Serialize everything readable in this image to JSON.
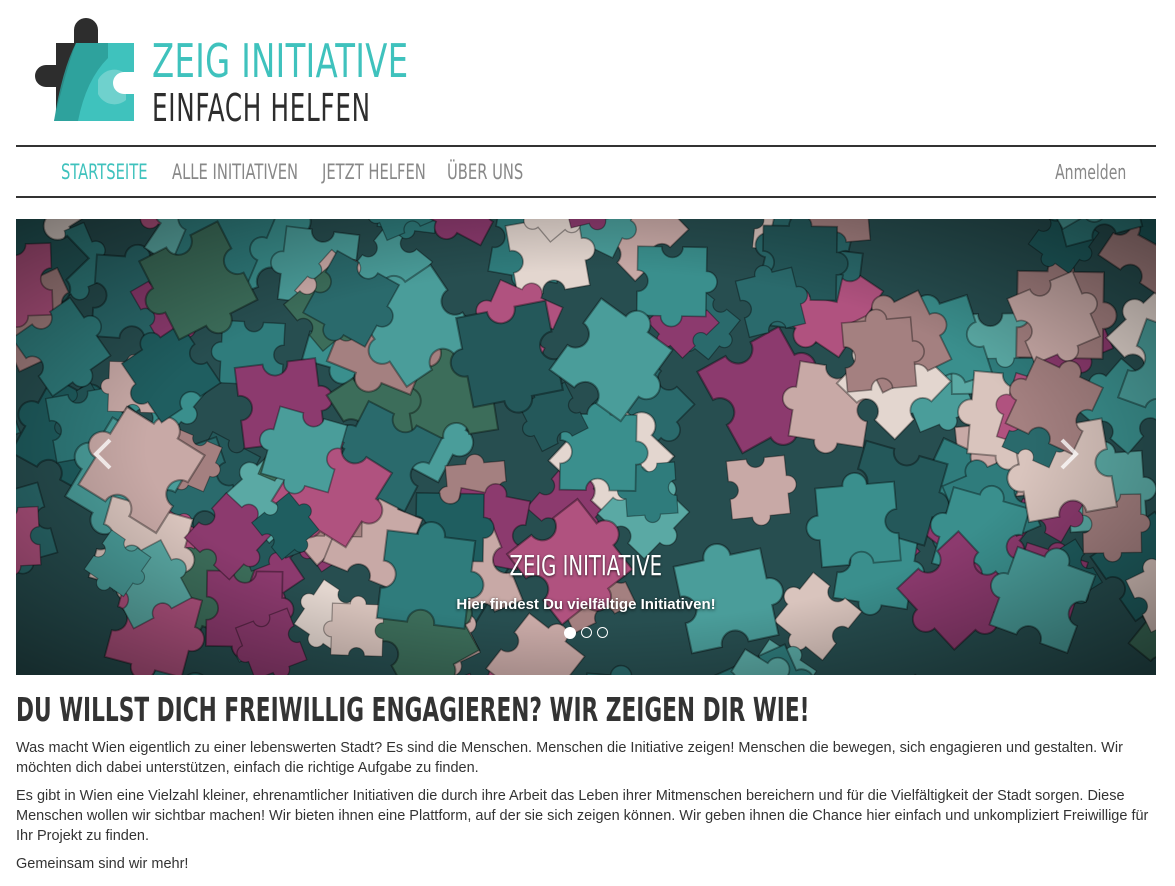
{
  "brand": {
    "title": "ZEIG INITIATIVE",
    "subtitle": "EINFACH HELFEN",
    "colors": {
      "accent": "#3fc2bd",
      "dark": "#2d2d2d",
      "nav_inactive": "#888888"
    }
  },
  "nav": {
    "items": [
      {
        "label": "STARTSEITE",
        "active": true
      },
      {
        "label": "ALLE INITIATIVEN",
        "active": false
      },
      {
        "label": "JETZT HELFEN",
        "active": false
      },
      {
        "label": "ÜBER UNS",
        "active": false
      }
    ],
    "login_label": "Anmelden"
  },
  "carousel": {
    "caption_title": "ZEIG INITIATIVE",
    "caption_text": "Hier findest Du vielfältige Initiativen!",
    "slides": 3,
    "active_slide": 1,
    "prev_icon": "chevron-left-icon",
    "next_icon": "chevron-right-icon"
  },
  "main": {
    "headline": "Du willst dich freiwillig engagieren? Wir zeigen dir wie!",
    "paragraphs": [
      "Was macht Wien eigentlich zu einer lebenswerten Stadt? Es sind die Menschen. Menschen die Initiative zeigen! Menschen die bewegen, sich engagieren und gestalten. Wir möchten dich dabei unterstützen, einfach die richtige Aufgabe zu finden.",
      "Es gibt in Wien eine Vielzahl kleiner, ehrenamtlicher Initiativen die durch ihre Arbeit das Leben ihrer Mitmenschen bereichern und für die Vielfältigkeit der Stadt sorgen. Diese Menschen wollen wir sichtbar machen! Wir bieten ihnen eine Plattform, auf der sie sich zeigen können. Wir geben ihnen die Chance hier einfach und unkompliziert Freiwillige für Ihr Projekt zu finden.",
      "Gemeinsam sind wir mehr!"
    ]
  }
}
